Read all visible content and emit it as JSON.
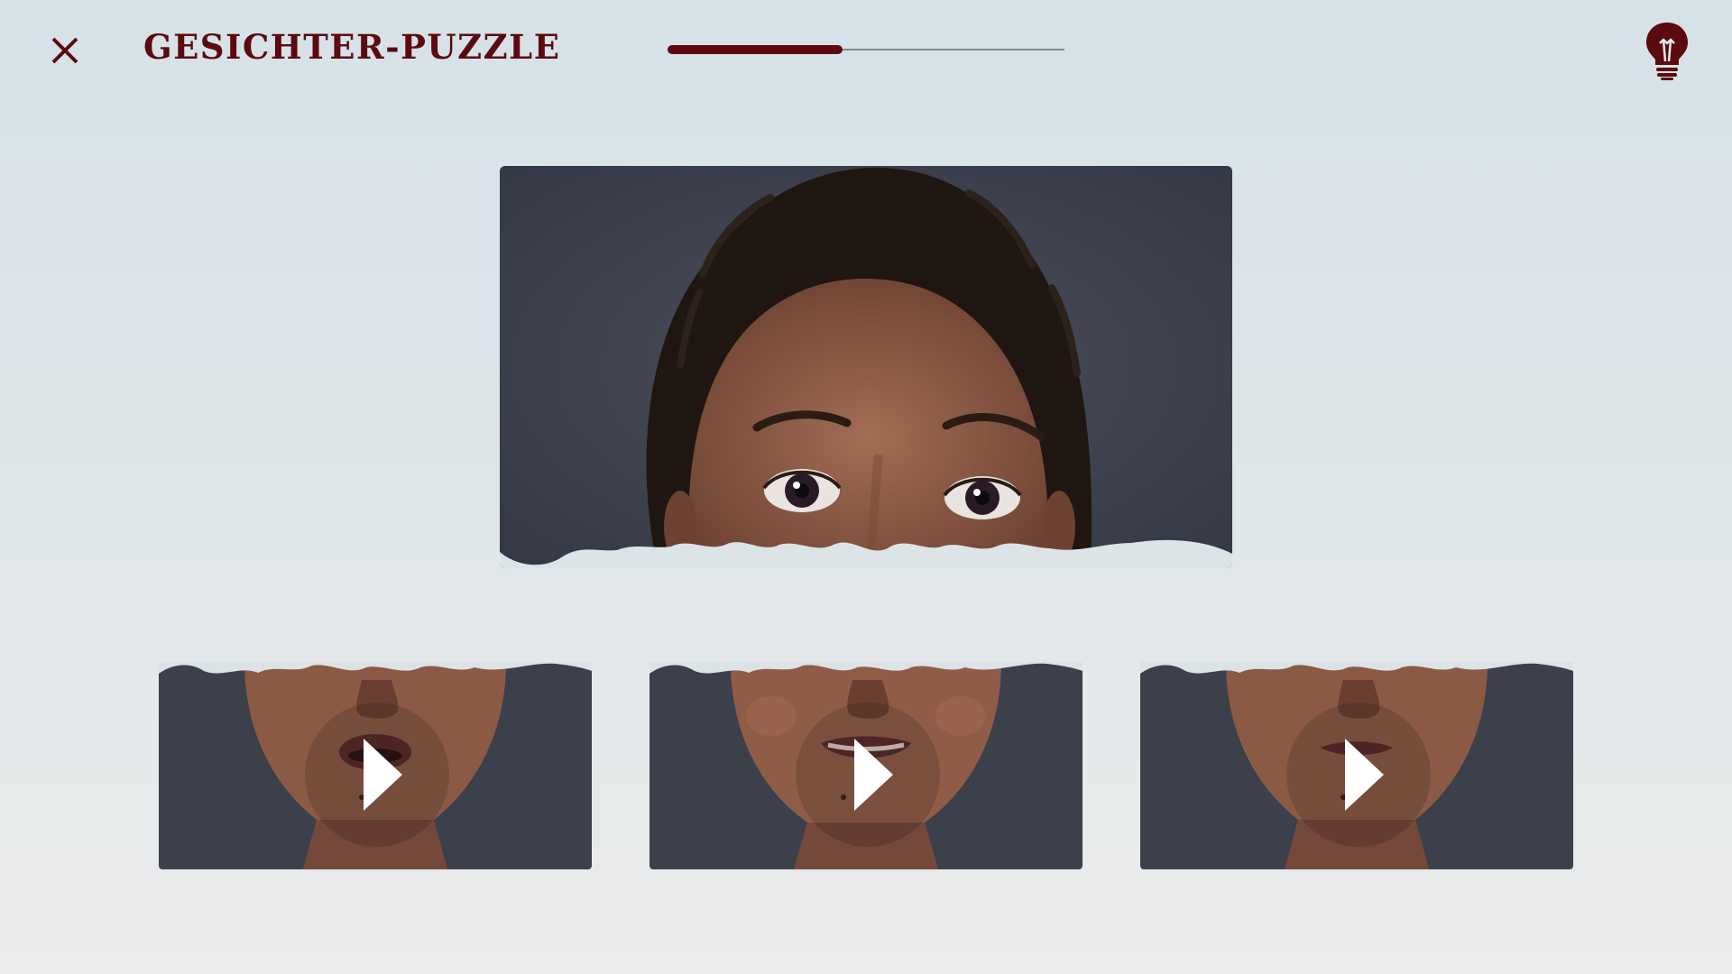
{
  "header": {
    "title": "GESICHTER-PUZZLE",
    "close_icon": "close-icon",
    "hint_icon": "lightbulb-icon"
  },
  "progress": {
    "value": 0.44
  },
  "puzzle": {
    "top_image": "face-upper-half-surprised-eyes",
    "options": [
      {
        "id": 1,
        "image": "face-lower-half-open-mouth",
        "icon": "play-icon"
      },
      {
        "id": 2,
        "image": "face-lower-half-smile",
        "icon": "play-icon"
      },
      {
        "id": 3,
        "image": "face-lower-half-neutral",
        "icon": "play-icon"
      }
    ]
  },
  "colors": {
    "accent": "#5c0a0f",
    "photo_background": "#3b404b",
    "skin": "#8a5a45",
    "hair": "#1f1612"
  }
}
